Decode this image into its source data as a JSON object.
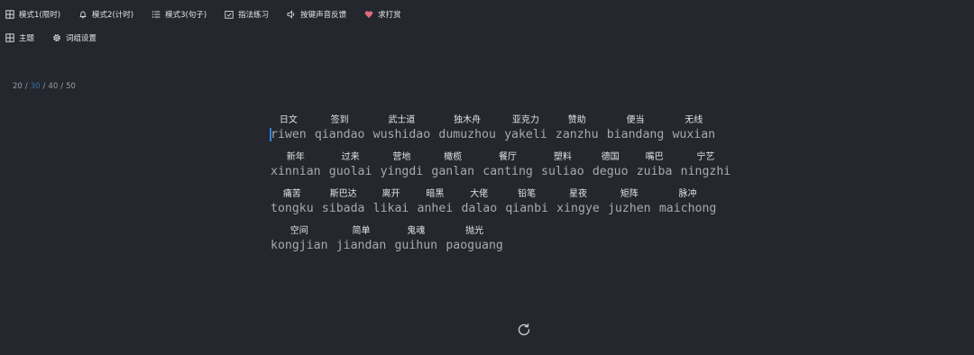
{
  "toolbar": {
    "row1": [
      {
        "label": "模式1(限时)",
        "icon": "grid-icon"
      },
      {
        "label": "模式2(计时)",
        "icon": "bell-icon"
      },
      {
        "label": "模式3(句子)",
        "icon": "list-icon"
      },
      {
        "label": "指法练习",
        "icon": "checkbox-icon"
      },
      {
        "label": "按键声音反馈",
        "icon": "speaker-icon"
      },
      {
        "label": "求打赏",
        "icon": "heart-icon"
      }
    ],
    "row2": [
      {
        "label": "主题",
        "icon": "grid-icon"
      },
      {
        "label": "词组设置",
        "icon": "gear-icon"
      }
    ]
  },
  "word_counts": {
    "options": [
      "20",
      "30",
      "40",
      "50"
    ],
    "active": "30",
    "separator": "/"
  },
  "colors": {
    "background": "#25272e",
    "accent": "#2d6fb0",
    "heart": "#e06a7a"
  },
  "lines": [
    [
      {
        "zh": "日文",
        "py": "riwen"
      },
      {
        "zh": "签到",
        "py": "qiandao"
      },
      {
        "zh": "武士道",
        "py": "wushidao"
      },
      {
        "zh": "独木舟",
        "py": "dumuzhou"
      },
      {
        "zh": "亚克力",
        "py": "yakeli"
      },
      {
        "zh": "赞助",
        "py": "zanzhu"
      },
      {
        "zh": "便当",
        "py": "biandang"
      },
      {
        "zh": "无线",
        "py": "wuxian"
      }
    ],
    [
      {
        "zh": "新年",
        "py": "xinnian"
      },
      {
        "zh": "过来",
        "py": "guolai"
      },
      {
        "zh": "营地",
        "py": "yingdi"
      },
      {
        "zh": "橄榄",
        "py": "ganlan"
      },
      {
        "zh": "餐厅",
        "py": "canting"
      },
      {
        "zh": "塑料",
        "py": "suliao"
      },
      {
        "zh": "德国",
        "py": "deguo"
      },
      {
        "zh": "嘴巴",
        "py": "zuiba"
      },
      {
        "zh": "宁艺",
        "py": "ningzhi"
      }
    ],
    [
      {
        "zh": "痛苦",
        "py": "tongku"
      },
      {
        "zh": "斯巴达",
        "py": "sibada"
      },
      {
        "zh": "离开",
        "py": "likai"
      },
      {
        "zh": "暗黑",
        "py": "anhei"
      },
      {
        "zh": "大佬",
        "py": "dalao"
      },
      {
        "zh": "铅笔",
        "py": "qianbi"
      },
      {
        "zh": "星夜",
        "py": "xingye"
      },
      {
        "zh": "矩阵",
        "py": "juzhen"
      },
      {
        "zh": "脉冲",
        "py": "maichong"
      }
    ],
    [
      {
        "zh": "空间",
        "py": "kongjian"
      },
      {
        "zh": "简单",
        "py": "jiandan"
      },
      {
        "zh": "鬼魂",
        "py": "guihun"
      },
      {
        "zh": "抛光",
        "py": "paoguang"
      }
    ]
  ],
  "refresh": {
    "icon": "refresh-icon"
  }
}
